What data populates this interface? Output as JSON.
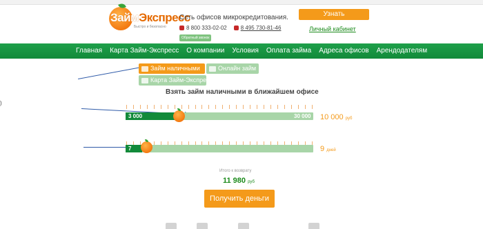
{
  "header": {
    "logo_name": "Займ",
    "logo_name_accent": "Экспресс",
    "logo_sub": "Быстро и безопасно",
    "tagline": "Сеть офисов микрокредитования.",
    "phone1": "8 800 333-02-02",
    "phone2": "8 495 730-81-46",
    "callback": "Обратный звонок",
    "debt_button": "Узнать задолженность",
    "cabinet_link": "Личный кабинет"
  },
  "nav": {
    "items": [
      "Главная",
      "Карта Займ-Экспресс",
      "О компании",
      "Условия",
      "Оплата займа",
      "Адреса офисов",
      "Арендодателям"
    ]
  },
  "tabs": {
    "cash": "Займ наличными",
    "online": "Онлайн займ",
    "card": "Карта Займ-Экспресс"
  },
  "calculator": {
    "heading": "Взять займ наличными в ближайшем офисе",
    "amount": {
      "min_label": "3 000",
      "max_label": "30 000",
      "value": "10 000",
      "unit": "руб",
      "min": 3000,
      "max": 30000,
      "current": 10000
    },
    "term": {
      "min_label": "7",
      "value": "9",
      "unit": "дней",
      "min": 7,
      "max": 30,
      "current": 9
    },
    "total_label": "Итого к возврату",
    "total_value": "11 980",
    "total_unit": "руб",
    "submit_button": "Получить деньги"
  },
  "edge_mark": ")",
  "colors": {
    "brand_orange": "#f49a1a",
    "brand_green": "#128a3a",
    "light_green": "#a8d5a8"
  }
}
